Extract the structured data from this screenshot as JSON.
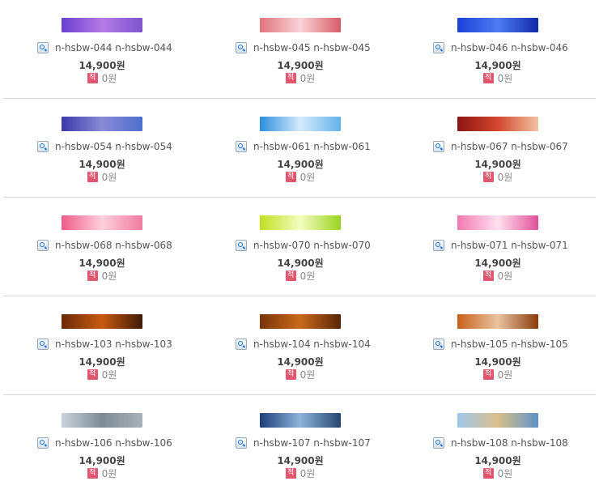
{
  "rows": [
    {
      "items": [
        {
          "name": "n-hsbw-044 n-hsbw-044",
          "price": "14,900원",
          "points": "0원",
          "badge": "적",
          "thumb_colors": [
            "#6a3fd0",
            "#b47be6",
            "#7d55cf"
          ]
        },
        {
          "name": "n-hsbw-045 n-hsbw-045",
          "price": "14,900원",
          "points": "0원",
          "badge": "적",
          "thumb_colors": [
            "#e2737c",
            "#f8d3d6",
            "#d65c68"
          ]
        },
        {
          "name": "n-hsbw-046 n-hsbw-046",
          "price": "14,900원",
          "points": "0원",
          "badge": "적",
          "thumb_colors": [
            "#1a40d8",
            "#4f7cf2",
            "#0e2aa9"
          ]
        }
      ]
    },
    {
      "items": [
        {
          "name": "n-hsbw-054 n-hsbw-054",
          "price": "14,900원",
          "points": "0원",
          "badge": "적",
          "thumb_colors": [
            "#3a3aa8",
            "#8a8ad8",
            "#4d6fce"
          ]
        },
        {
          "name": "n-hsbw-061 n-hsbw-061",
          "price": "14,900원",
          "points": "0원",
          "badge": "적",
          "thumb_colors": [
            "#2b8fdb",
            "#d3ecfb",
            "#63b2ea"
          ]
        },
        {
          "name": "n-hsbw-067 n-hsbw-067",
          "price": "14,900원",
          "points": "0원",
          "badge": "적",
          "thumb_colors": [
            "#8d1414",
            "#d3472d",
            "#f0c3a1"
          ]
        }
      ]
    },
    {
      "items": [
        {
          "name": "n-hsbw-068 n-hsbw-068",
          "price": "14,900원",
          "points": "0원",
          "badge": "적",
          "thumb_colors": [
            "#ee5b89",
            "#ffd0de",
            "#f07aa0"
          ]
        },
        {
          "name": "n-hsbw-070 n-hsbw-070",
          "price": "14,900원",
          "points": "0원",
          "badge": "적",
          "thumb_colors": [
            "#c0e020",
            "#f3fdc0",
            "#9bd31e"
          ]
        },
        {
          "name": "n-hsbw-071 n-hsbw-071",
          "price": "14,900원",
          "points": "0원",
          "badge": "적",
          "thumb_colors": [
            "#f07ab0",
            "#ffe0ef",
            "#e2509a"
          ]
        }
      ]
    },
    {
      "items": [
        {
          "name": "n-hsbw-103 n-hsbw-103",
          "price": "14,900원",
          "points": "0원",
          "badge": "적",
          "thumb_colors": [
            "#6a2b06",
            "#c75a10",
            "#3e1a05"
          ]
        },
        {
          "name": "n-hsbw-104 n-hsbw-104",
          "price": "14,900원",
          "points": "0원",
          "badge": "적",
          "thumb_colors": [
            "#7a3408",
            "#c86a1a",
            "#5a2506"
          ]
        },
        {
          "name": "n-hsbw-105 n-hsbw-105",
          "price": "14,900원",
          "points": "0원",
          "badge": "적",
          "thumb_colors": [
            "#c9611a",
            "#e9c3a0",
            "#8a3b0b"
          ]
        }
      ]
    },
    {
      "items": [
        {
          "name": "n-hsbw-106 n-hsbw-106",
          "price": "14,900원",
          "points": "0원",
          "badge": "적",
          "thumb_colors": [
            "#c9d3db",
            "#7d8a94",
            "#a9b2b9"
          ]
        },
        {
          "name": "n-hsbw-107 n-hsbw-107",
          "price": "14,900원",
          "points": "0원",
          "badge": "적",
          "thumb_colors": [
            "#1d3e7a",
            "#8fb3d8",
            "#24466f"
          ]
        },
        {
          "name": "n-hsbw-108 n-hsbw-108",
          "price": "14,900원",
          "points": "0원",
          "badge": "적",
          "thumb_colors": [
            "#9ec6ea",
            "#d9c089",
            "#5f92c8"
          ]
        }
      ]
    }
  ]
}
